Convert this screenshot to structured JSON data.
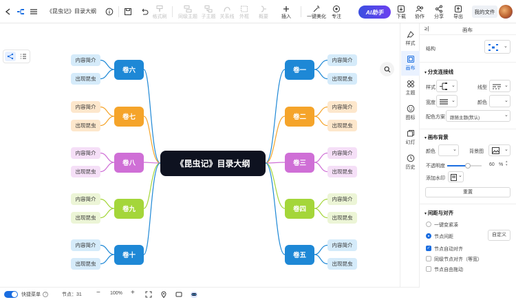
{
  "toolbar": {
    "title": "《昆虫记》目录大纲",
    "format_painter": "格式刷",
    "sibling_topic": "同级主题",
    "child_topic": "子主题",
    "relation": "关系线",
    "boundary": "外框",
    "summary": "概要",
    "insert": "插入",
    "beautify": "一键美化",
    "focus": "专注",
    "ai": "AI助手",
    "download": "下载",
    "collab": "协作",
    "share": "分享",
    "export": "导出",
    "my_files": "我的文件"
  },
  "mindmap": {
    "root": "《昆虫记》目录大纲",
    "sub_intro": "内容简介",
    "sub_bug": "出现昆虫",
    "right": [
      {
        "label": "卷一",
        "color": "#1e88d6",
        "sub_bg": "#d5ebfa"
      },
      {
        "label": "卷二",
        "color": "#f5a42a",
        "sub_bg": "#fde7cc"
      },
      {
        "label": "卷三",
        "color": "#cf6fd6",
        "sub_bg": "#f5dff7"
      },
      {
        "label": "卷四",
        "color": "#a4d63a",
        "sub_bg": "#ecf5d6"
      },
      {
        "label": "卷五",
        "color": "#1e88d6",
        "sub_bg": "#d5ebfa"
      }
    ],
    "left": [
      {
        "label": "卷六",
        "color": "#1e88d6",
        "sub_bg": "#d5ebfa"
      },
      {
        "label": "卷七",
        "color": "#f5a42a",
        "sub_bg": "#fde7cc"
      },
      {
        "label": "卷八",
        "color": "#cf6fd6",
        "sub_bg": "#f5dff7"
      },
      {
        "label": "卷九",
        "color": "#a4d63a",
        "sub_bg": "#ecf5d6"
      },
      {
        "label": "卷十",
        "color": "#1e88d6",
        "sub_bg": "#d5ebfa"
      }
    ]
  },
  "statusbar": {
    "shortcut_label": "快捷菜单",
    "node_count": "节点：31",
    "zoom": "100%"
  },
  "rail": [
    "样式",
    "画布",
    "主题",
    "图标",
    "幻灯",
    "历史"
  ],
  "panel": {
    "header": "画布",
    "structure": "结构",
    "branch_section": "分支连接线",
    "style": "样式",
    "line_type": "线型",
    "width": "宽度",
    "color": "颜色",
    "color_scheme": "配色方案",
    "color_scheme_value": "跟随主题(默认)",
    "bg_section": "画布背景",
    "bg_color": "颜色",
    "bg_image": "背景图",
    "opacity": "不透明度",
    "opacity_value": "60",
    "percent": "%",
    "watermark": "添加水印",
    "reset": "重置",
    "spacing_section": "间距与对齐",
    "compact": "一键变紧凑",
    "node_spacing": "节点间距",
    "custom": "自定义",
    "auto_align": "节点自动对齐",
    "same_level": "同级节点对齐（等宽）",
    "free_drag": "节点自由拖动"
  }
}
